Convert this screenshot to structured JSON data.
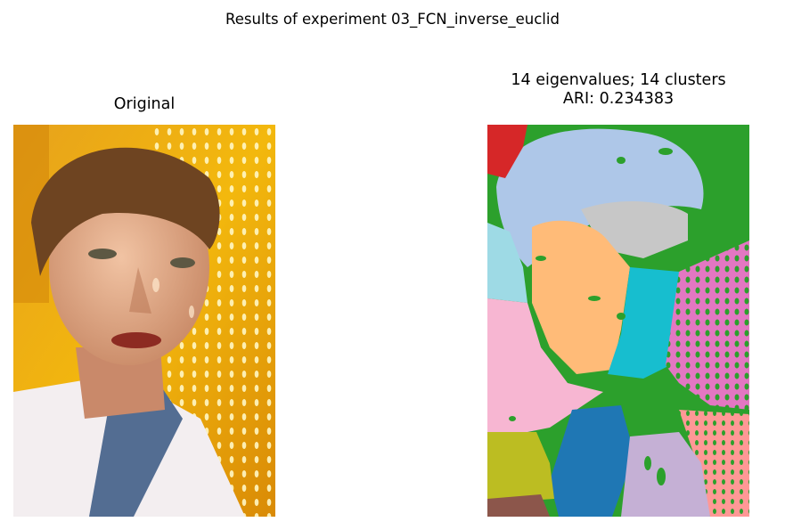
{
  "figure": {
    "suptitle": "Results of experiment 03_FCN_inverse_euclid"
  },
  "left_panel": {
    "title": "Original",
    "image_description": "photo"
  },
  "right_panel": {
    "title_line1": "14 eigenvalues; 14 clusters",
    "title_line2": "ARI: 0.234383",
    "segment_colors": [
      "#2ca02c",
      "#aec7e8",
      "#d62728",
      "#9edae5",
      "#c7c7c7",
      "#ffbb78",
      "#17becf",
      "#f7b6d2",
      "#e377c2",
      "#1f77b4",
      "#c5b0d5",
      "#bcbd22",
      "#ff9896",
      "#8c564b"
    ]
  }
}
